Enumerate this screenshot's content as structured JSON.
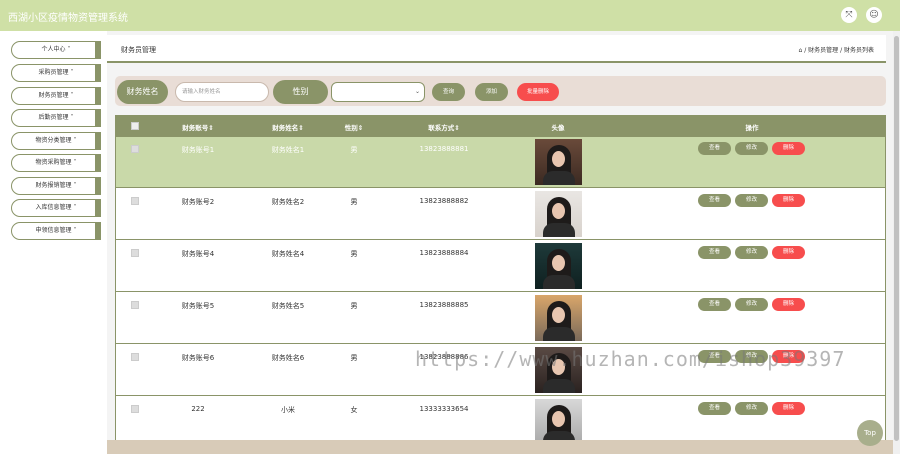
{
  "header": {
    "title": "西湖小区疫情物资管理系统",
    "icons": [
      "fullscreen-icon",
      "user-icon"
    ]
  },
  "sidebar": {
    "items": [
      {
        "label": "个人中心 ˅"
      },
      {
        "label": "采购员管理 ˅"
      },
      {
        "label": "财务员管理 ˅"
      },
      {
        "label": "后勤员管理 ˅"
      },
      {
        "label": "物资分类管理 ˅"
      },
      {
        "label": "物资采购管理 ˅"
      },
      {
        "label": "财务报销管理 ˅"
      },
      {
        "label": "入库信息管理 ˅"
      },
      {
        "label": "申领信息管理 ˅"
      }
    ]
  },
  "page": {
    "title": "财务员管理",
    "breadcrumb": "/ 财务员管理 / 财务员列表"
  },
  "search": {
    "name_label": "财务姓名",
    "name_placeholder": "请输入财务姓名",
    "gender_label": "性别",
    "gender_value": "",
    "query_button": "查询",
    "add_button": "添加",
    "batch_delete_button": "批量删除"
  },
  "table": {
    "columns": [
      "财务账号⇕",
      "财务姓名⇕",
      "性别⇕",
      "联系方式⇕",
      "头像",
      "操作"
    ],
    "action_labels": {
      "view": "查看",
      "edit": "修改",
      "delete": "删除"
    },
    "rows": [
      {
        "account": "财务账号1",
        "name": "财务姓名1",
        "gender": "男",
        "phone": "13823888881",
        "highlighted": true
      },
      {
        "account": "财务账号2",
        "name": "财务姓名2",
        "gender": "男",
        "phone": "13823888882",
        "highlighted": false
      },
      {
        "account": "财务账号4",
        "name": "财务姓名4",
        "gender": "男",
        "phone": "13823888884",
        "highlighted": false
      },
      {
        "account": "财务账号5",
        "name": "财务姓名5",
        "gender": "男",
        "phone": "13823888885",
        "highlighted": false
      },
      {
        "account": "财务账号6",
        "name": "财务姓名6",
        "gender": "男",
        "phone": "13823888886",
        "highlighted": false
      },
      {
        "account": "222",
        "name": "小米",
        "gender": "女",
        "phone": "13333333654",
        "highlighted": false
      }
    ]
  },
  "watermark": "https://www.huzhan.com/ishop39397",
  "top_button": "Top",
  "colors": {
    "accent": "#8a9468",
    "header": "#cfe0a6",
    "danger": "#f74d4d",
    "highlight_row": "#c9d9a9"
  }
}
